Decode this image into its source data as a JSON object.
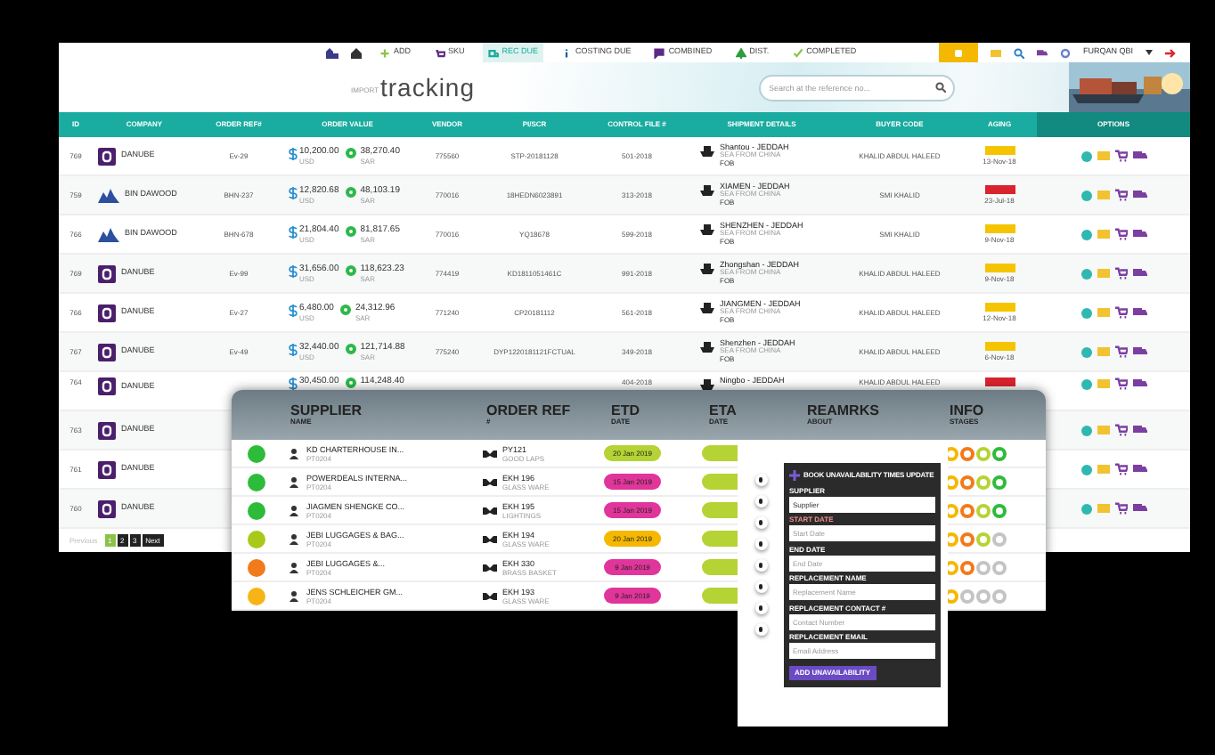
{
  "nav": {
    "items": [
      {
        "label": "ADD",
        "selected": false
      },
      {
        "label": "SKU",
        "selected": false
      },
      {
        "label": "REC DUE",
        "selected": true
      },
      {
        "label": "COSTING DUE",
        "selected": false
      },
      {
        "label": "COMBINED",
        "selected": false
      },
      {
        "label": "DIST.",
        "selected": false
      },
      {
        "label": "COMPLETED",
        "selected": false
      }
    ],
    "user": "FURQAN QBI"
  },
  "header": {
    "logo_small": "IMPORT",
    "logo": "tracking",
    "search_placeholder": "Search at the reference no..."
  },
  "table": {
    "columns": [
      "ID",
      "COMPANY",
      "ORDER REF#",
      "ORDER VALUE",
      "VENDOR",
      "PI/SCR",
      "CONTROL FILE #",
      "SHIPMENT DETAILS",
      "BUYER CODE",
      "AGING",
      "OPTIONS"
    ],
    "rows": [
      {
        "id": "769",
        "company": "DANUBE",
        "kind": "danube",
        "ref": "Ev-29",
        "usd": "10,200.00",
        "usd_cur": "USD",
        "sar": "38,270.40",
        "sar_cur": "SAR",
        "vendor": "775560",
        "pi": "STP-20181128",
        "control": "501-2018",
        "route": "Shantou - JEDDAH",
        "mode": "SEA FROM CHINA",
        "terms": "FOB",
        "buyer": "KHALID ABDUL HALEED",
        "color": "#f5c400",
        "aging_date": "13-Nov-18"
      },
      {
        "id": "759",
        "company": "BIN DAWOOD",
        "kind": "bindawood",
        "ref": "BHN-237",
        "usd": "12,820.68",
        "usd_cur": "USD",
        "sar": "48,103.19",
        "sar_cur": "SAR",
        "vendor": "770016",
        "pi": "18HEDN6023891",
        "control": "313-2018",
        "route": "XIAMEN - JEDDAH",
        "mode": "SEA FROM CHINA",
        "terms": "FOB",
        "buyer": "SMI KHALID",
        "color": "#d9232e",
        "aging_date": "23-Jul-18"
      },
      {
        "id": "766",
        "company": "BIN DAWOOD",
        "kind": "bindawood",
        "ref": "BHN-678",
        "usd": "21,804.40",
        "usd_cur": "USD",
        "sar": "81,817.65",
        "sar_cur": "SAR",
        "vendor": "770016",
        "pi": "YQ18678",
        "control": "599-2018",
        "route": "SHENZHEN - JEDDAH",
        "mode": "SEA FROM CHINA",
        "terms": "FOB",
        "buyer": "SMI KHALID",
        "color": "#f5c400",
        "aging_date": "9-Nov-18"
      },
      {
        "id": "769",
        "company": "DANUBE",
        "kind": "danube",
        "ref": "Ev-99",
        "usd": "31,656.00",
        "usd_cur": "USD",
        "sar": "118,623.23",
        "sar_cur": "SAR",
        "vendor": "774419",
        "pi": "KD1811051461C",
        "control": "991-2018",
        "route": "Zhongshan - JEDDAH",
        "mode": "SEA FROM CHINA",
        "terms": "FOB",
        "buyer": "KHALID ABDUL HALEED",
        "color": "#f5c400",
        "aging_date": "9-Nov-18"
      },
      {
        "id": "766",
        "company": "DANUBE",
        "kind": "danube",
        "ref": "Ev-27",
        "usd": "6,480.00",
        "usd_cur": "USD",
        "sar": "24,312.96",
        "sar_cur": "SAR",
        "vendor": "771240",
        "pi": "CP20181112",
        "control": "561-2018",
        "route": "JIANGMEN - JEDDAH",
        "mode": "SEA FROM CHINA",
        "terms": "FOB",
        "buyer": "KHALID ABDUL HALEED",
        "color": "#f5c400",
        "aging_date": "12-Nov-18"
      },
      {
        "id": "767",
        "company": "DANUBE",
        "kind": "danube",
        "ref": "Ev-49",
        "usd": "32,440.00",
        "usd_cur": "USD",
        "sar": "121,714.88",
        "sar_cur": "SAR",
        "vendor": "775240",
        "pi": "DYP1220181121FCTUAL",
        "control": "349-2018",
        "route": "Shenzhen - JEDDAH",
        "mode": "SEA FROM CHINA",
        "terms": "FOB",
        "buyer": "KHALID ABDUL HALEED",
        "color": "#f5c400",
        "aging_date": "6-Nov-18"
      },
      {
        "id": "764",
        "company": "DANUBE",
        "kind": "danube",
        "usd": "30,450.00",
        "sar": "114,248.40",
        "control": "404-2018",
        "route": "Ningbo - JEDDAH",
        "buyer": "KHALID ABDUL HALEED",
        "color": "#d9232e"
      },
      {
        "id": "763",
        "company": "DANUBE",
        "kind": "danube"
      },
      {
        "id": "761",
        "company": "DANUBE",
        "kind": "danube"
      },
      {
        "id": "760",
        "company": "DANUBE",
        "kind": "danube"
      }
    ]
  },
  "pagination": {
    "previous": "Previous",
    "pages": [
      {
        "label": "1",
        "selected": true
      },
      {
        "label": "2",
        "selected": false
      },
      {
        "label": "3",
        "selected": false
      }
    ],
    "next": "Next"
  },
  "suppliers": {
    "columns": [
      {
        "title": "SUPPLIER",
        "sub": "NAME"
      },
      {
        "title": "ORDER REF",
        "sub": "#"
      },
      {
        "title": "ETD",
        "sub": "DATE"
      },
      {
        "title": "ETA",
        "sub": "DATE"
      },
      {
        "title": "REAMRKS",
        "sub": "ABOUT"
      },
      {
        "title": "INFO",
        "sub": "STAGES"
      }
    ],
    "rows": [
      {
        "color": "#2dbb3a",
        "name": "KD CHARTERHOUSE IN...",
        "code": "PT0204",
        "ref": "PY121",
        "ref_sub": "GOOD LAPS",
        "etd": {
          "date": "20 Jan 2019",
          "color": "#b5d334"
        },
        "eta": {
          "color": "#b5d334"
        },
        "stages": [
          {
            "color": "#f5b800"
          },
          {
            "color": "#f27a1a"
          },
          {
            "color": "#b5d334"
          },
          {
            "color": "#2dbb3a"
          }
        ]
      },
      {
        "color": "#2dbb3a",
        "name": "POWERDEALS INTERNA...",
        "code": "PT0204",
        "ref": "EKH 196",
        "ref_sub": "GLASS WARE",
        "etd": {
          "date": "15 Jan 2019",
          "color": "#e0359a"
        },
        "eta": {
          "color": "#b5d334"
        },
        "stages": [
          {
            "color": "#f5b800"
          },
          {
            "color": "#f27a1a"
          },
          {
            "color": "#b5d334"
          },
          {
            "color": "#2dbb3a"
          }
        ]
      },
      {
        "color": "#2dbb3a",
        "name": "JIAGMEN SHENGKE CO...",
        "code": "PT0204",
        "ref": "EKH 195",
        "ref_sub": "LIGHTINGS",
        "etd": {
          "date": "15 Jan 2019",
          "color": "#e0359a"
        },
        "eta": {
          "color": "#b5d334"
        },
        "stages": [
          {
            "color": "#f5b800"
          },
          {
            "color": "#f27a1a"
          },
          {
            "color": "#b5d334"
          },
          {
            "color": "#2dbb3a"
          }
        ]
      },
      {
        "color": "#a8c81a",
        "name": "JEBI LUGGAGES & BAG...",
        "code": "PT0204",
        "ref": "EKH 194",
        "ref_sub": "GLASS WARE",
        "etd": {
          "date": "20 Jan 2019",
          "color": "#f5b800"
        },
        "eta": {
          "color": "#b5d334"
        },
        "stages": [
          {
            "color": "#f5b800"
          },
          {
            "color": "#f27a1a"
          },
          {
            "color": "#b5d334"
          },
          {
            "color": "#c4c4c4"
          }
        ]
      },
      {
        "color": "#f27a1a",
        "name": "JEBI LUGGAGES &...",
        "code": "PT0204",
        "ref": "EKH 330",
        "ref_sub": "BRASS BASKET",
        "etd": {
          "date": "9 Jan 2019",
          "color": "#e0359a"
        },
        "eta": {
          "color": "#b5d334"
        },
        "stages": [
          {
            "color": "#f5b800"
          },
          {
            "color": "#f27a1a"
          },
          {
            "color": "#c4c4c4"
          },
          {
            "color": "#c4c4c4"
          }
        ]
      },
      {
        "color": "#f7b416",
        "name": "JENS SCHLEICHER GM...",
        "code": "PT0204",
        "ref": "EKH 193",
        "ref_sub": "GLASS WARE",
        "etd": {
          "date": "9 Jan 2019",
          "color": "#e0359a"
        },
        "eta": {
          "color": "#b5d334"
        },
        "stages": [
          {
            "color": "#f5b800"
          },
          {
            "color": "#c4c4c4"
          },
          {
            "color": "#c4c4c4"
          },
          {
            "color": "#c4c4c4"
          }
        ]
      }
    ]
  },
  "form": {
    "title": "BOOK UNAVAILABILITY TIMES UPDATE",
    "fields": [
      {
        "label": "SUPPLIER",
        "value": "Supplier"
      },
      {
        "label": "START DATE",
        "placeholder": "Start Date"
      },
      {
        "label": "END DATE",
        "placeholder": "End Date"
      },
      {
        "label": "REPLACEMENT NAME",
        "placeholder": "Replacement Name"
      },
      {
        "label": "REPLACEMENT CONTACT #",
        "placeholder": "Contact Number"
      },
      {
        "label": "REPLACEMENT EMAIL",
        "placeholder": "Email Address"
      }
    ],
    "button": "ADD UNAVAILABILITY"
  }
}
